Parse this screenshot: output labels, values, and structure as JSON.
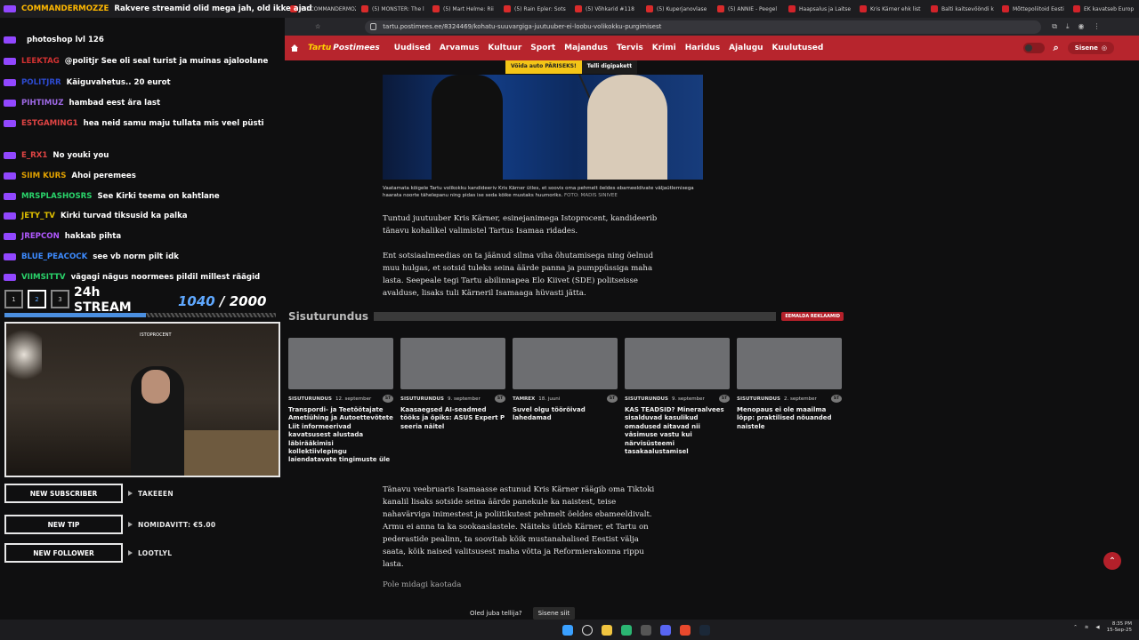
{
  "browser": {
    "tabs": [
      {
        "label": "(5) COMMANDERMOZZE",
        "icon": "youtube"
      },
      {
        "label": "(5) MONSTER: The l",
        "icon": "youtube"
      },
      {
        "label": "(5) Mart Helme: Rii",
        "icon": "youtube"
      },
      {
        "label": "(5) Rain Epler: Sots",
        "icon": "youtube"
      },
      {
        "label": "(5) Võhkarid #118",
        "icon": "youtube"
      },
      {
        "label": "(5) Kuperjanovlase",
        "icon": "youtube"
      },
      {
        "label": "(5) ANNIE - Peegel",
        "icon": "youtube"
      },
      {
        "label": "Haapsalus ja Laitse",
        "icon": "postimees"
      },
      {
        "label": "Kris Kärner ehk list",
        "icon": "postimees"
      },
      {
        "label": "Balti kaitsevööndi k",
        "icon": "postimees"
      },
      {
        "label": "Mõttepoliitoid Eesti",
        "icon": "postimees"
      },
      {
        "label": "EK kavatseb Europ",
        "icon": "postimees"
      }
    ],
    "new_tab": "+",
    "url": "tartu.postimees.ee/8324469/kohatu-suuvargiga-juutuuber-ei-loobu-volikokku-purgimisest"
  },
  "site": {
    "logo_prefix": "Tartu",
    "logo_main": "Postimees",
    "nav": [
      "Uudised",
      "Arvamus",
      "Kultuur",
      "Sport",
      "Majandus",
      "Tervis",
      "Krimi",
      "Haridus",
      "Ajalugu",
      "Kuulutused"
    ],
    "login": "Sisene",
    "promo_a": "Võida auto PÄRISEKS!",
    "promo_b": "Telli digipakett"
  },
  "article": {
    "caption": "Vaatamata kõigele Tartu volikokku kandideeriv Kris Kärner ütles, et soovis oma pehmelt öeldes ebameeldivate väljaütlemisega haarata noorte tähelepanu ning pidas ise seda kõike mustaks huumoriks.",
    "caption_source": "FOTO: MADIS SINIVEE",
    "paragraphs": [
      "Tuntud juutuuber Kris Kärner, esinejanimega Istoprocent, kandideerib tänavu kohalikel valimistel Tartus Isamaa ridades.",
      "Ent sotsiaalmeedias on ta jäänud silma viha õhutamisega ning õelnud muu hulgas, et sotsid tuleks seina äärde panna ja pumppüssiga maha lasta. Seepeale tegi Tartu abilinnapea Elo Kiivet (SDE) politseisse avalduse, lisaks tuli Kärneril Isamaaga hüvasti jätta.",
      "Tänavu veebruaris Isamaasse astunud Kris Kärner räägib oma Tiktoki kanalil lisaks sotside seina äärde panekule ka naistest, teise nahavärviga inimestest ja poliitikutest pehmelt öeldes ebameeldivalt. Armu ei anna ta ka sookaaslastele. Näiteks ütleb Kärner, et Tartu on pederastide pealinn, ta soovitab kõik mustanahalised Eestist välja saata, kõik naised valitsusest maha võtta ja Reformierakonna rippu lasta."
    ],
    "subheading": "Pole midagi kaotada",
    "sponsored_title": "Sisuturundus",
    "remove_ads": "EEMALDA REKLAAMID",
    "subscriber_q": "Oled juba tellija?",
    "subscriber_login": "Sisene siit"
  },
  "cards": [
    {
      "cat": "SISUTURUNDUS",
      "date": "12. september",
      "badge": "ST",
      "title": "Transpordi- ja Teetöötajate Ametiühing ja Autoettevõtete Liit informeerivad kavatsusest alustada läbirääkimisi kollektiivlepingu laiendatavate tingimuste üle"
    },
    {
      "cat": "SISUTURUNDUS",
      "date": "9. september",
      "badge": "ST",
      "title": "Kaasaegsed AI-seadmed tööks ja õpiks: ASUS Expert P seeria näitel"
    },
    {
      "cat": "TAMREX",
      "date": "18. juuni",
      "badge": "ST",
      "title": "Suvel olgu töörõivad lahedamad"
    },
    {
      "cat": "SISUTURUNDUS",
      "date": "9. september",
      "badge": "ST",
      "title": "KAS TEADSID? Mineraalvees sisalduvad kasulikud omadused aitavad nii väsimuse vastu kui närvisüsteemi tasakaalustamisel"
    },
    {
      "cat": "SISUTURUNDUS",
      "date": "2. september",
      "badge": "ST",
      "title": "Menopaus ei ole maailma lõpp: praktilised nõuanded naistele"
    }
  ],
  "chat": [
    {
      "user": "COMMANDERMOZZE",
      "color": "#ffb800",
      "msg": "Rakvere streamid olid mega jah, old ikke ajad"
    },
    {
      "user": "",
      "color": "#d03131",
      "msg": "photoshop lvl 126"
    },
    {
      "user": "LEEKTAG",
      "color": "#d03131",
      "msg": "@politjr See oli seal turist ja muinas ajaloolane"
    },
    {
      "user": "POLITJRR",
      "color": "#2d4bd1",
      "msg": "Käiguvahetus.. 20 eurot"
    },
    {
      "user": "PIHTIMUZ",
      "color": "#9f69e6",
      "msg": "hambad eest ära last"
    },
    {
      "user": "ESTGAMING1",
      "color": "#e04444",
      "msg": "hea neid samu maju tullata mis veel püsti"
    },
    {
      "user": "E_RX1",
      "color": "#e04444",
      "msg": "No youki you"
    },
    {
      "user": "SIIM KURS",
      "color": "#e0a000",
      "msg": "Ahoi peremees"
    },
    {
      "user": "MRSPLASHOSRS",
      "color": "#2ad46b",
      "msg": "See Kirki teema on kahtlane"
    },
    {
      "user": "JETY_TV",
      "color": "#e0c000",
      "msg": "Kirki turvad tiksusid ka palka"
    },
    {
      "user": "JREPCON",
      "color": "#b058ff",
      "msg": "hakkab pihta"
    },
    {
      "user": "BLUE_PEACOCK",
      "color": "#3d8bff",
      "msg": "see vb norm pilt idk"
    },
    {
      "user": "VIIMSITTV",
      "color": "#2ad46b",
      "msg": "vägagi nägus noormees pildil millest räägid"
    }
  ],
  "overlay": {
    "tabs": [
      "1",
      "2",
      "3"
    ],
    "stream_label_1": "24h",
    "stream_label_2": "STREAM",
    "sub_current": "1040",
    "sub_sep": "/",
    "sub_goal": "2000",
    "sub_progress": 0.52,
    "webcam_tag": "ISTOPROCENT",
    "alerts": [
      {
        "label": "NEW SUBSCRIBER",
        "value": "TAKEEEN"
      },
      {
        "label": "NEW TIP",
        "value": "NOMIDAVITT: €5.00"
      },
      {
        "label": "NEW FOLLOWER",
        "value": "LOOTLYL"
      }
    ]
  },
  "system": {
    "time": "8:35 PM",
    "date": "15-Sep-25"
  },
  "colors": {
    "brand_red": "#b7252d",
    "promo_yellow": "#f4c517",
    "accent_blue": "#5fa8ff"
  }
}
